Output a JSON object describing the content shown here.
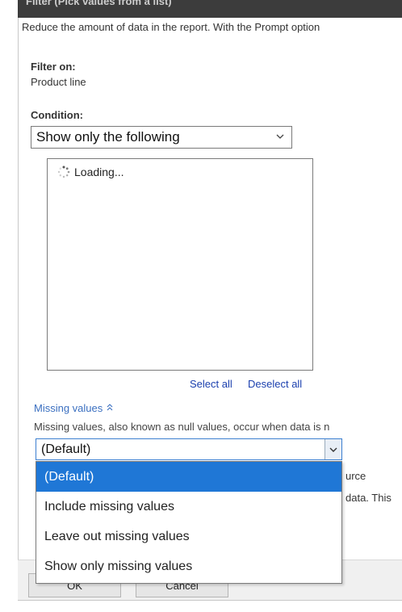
{
  "window": {
    "title": "Filter (Pick values from a list)"
  },
  "intro_text": "Reduce the amount of data in the report. With the Prompt option",
  "filter_on": {
    "label": "Filter on:",
    "value": "Product line"
  },
  "condition": {
    "label": "Condition:",
    "selected": "Show only the following",
    "chevron_icon": "chevron-down"
  },
  "values_list": {
    "loading_text": "Loading...",
    "spinner_icon": "spinner"
  },
  "links": {
    "select_all": "Select all",
    "deselect_all": "Deselect all",
    "color": "#1a3fae"
  },
  "missing_values": {
    "title": "Missing values",
    "toggle_icon": "chevron-up-double",
    "description": "Missing values, also known as null values, occur when data is n",
    "selected": "(Default)",
    "options": [
      "(Default)",
      "Include missing values",
      "Leave out missing values",
      "Show only missing values"
    ],
    "behind_text_1": "urce",
    "behind_text_2": "data. This"
  },
  "buttons": {
    "ok": "OK",
    "cancel": "Cancel"
  },
  "colors": {
    "highlight": "#1f77d6",
    "link": "#3a6fc0"
  }
}
